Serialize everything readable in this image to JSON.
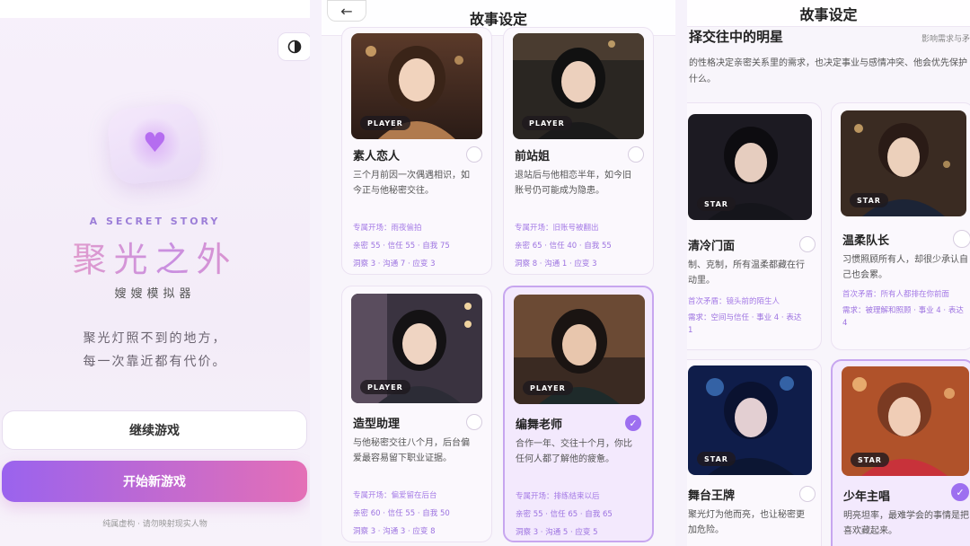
{
  "title_screen": {
    "eyebrow": "A SECRET STORY",
    "title": "聚光之外",
    "subtitle": "嫂嫂模拟器",
    "tagline_1": "聚光灯照不到的地方，",
    "tagline_2": "每一次靠近都有代价。",
    "continue_label": "继续游戏",
    "new_game_label": "开始新游戏",
    "disclaimer": "纯属虚构 · 请勿映射现实人物"
  },
  "story_setup": {
    "header_title": "故事设定",
    "back_icon": "←",
    "player_cards": [
      {
        "name": "素人恋人",
        "tag": "PLAYER",
        "selected": false,
        "desc": "三个月前因一次偶遇相识，如今正与他秘密交往。",
        "special": "专属开场：雨夜偷拍",
        "stats_1": "亲密 55 · 信任 55 · 自我 75",
        "stats_2": "洞察 3 · 沟通 7 · 应变 3"
      },
      {
        "name": "前站姐",
        "tag": "PLAYER",
        "selected": false,
        "desc": "退站后与他相恋半年，如今旧账号仍可能成为隐患。",
        "special": "专属开场：旧账号被翻出",
        "stats_1": "亲密 65 · 信任 40 · 自我 55",
        "stats_2": "洞察 8 · 沟通 1 · 应变 3"
      },
      {
        "name": "造型助理",
        "tag": "PLAYER",
        "selected": false,
        "desc": "与他秘密交往八个月，后台偏爱最容易留下职业证据。",
        "special": "专属开场：偏爱留在后台",
        "stats_1": "亲密 60 · 信任 55 · 自我 50",
        "stats_2": "洞察 3 · 沟通 3 · 应变 8"
      },
      {
        "name": "编舞老师",
        "tag": "PLAYER",
        "selected": true,
        "desc": "合作一年、交往十个月，你比任何人都了解他的疲惫。",
        "special": "专属开场：排练结束以后",
        "stats_1": "亲密 55 · 信任 65 · 自我 65",
        "stats_2": "洞察 3 · 沟通 5 · 应变 5"
      }
    ]
  },
  "star_select": {
    "header_title": "故事设定",
    "section_title": "择交往中的明星",
    "section_right": "影响需求与矛",
    "section_desc": "的性格决定亲密关系里的需求，也决定事业与感情冲突、他会优先保护什么。",
    "star_cards": [
      {
        "name": "清冷门面",
        "tag": "STAR",
        "selected": false,
        "desc": "制、克制，所有温柔都藏在行动里。",
        "conflict": "首次矛盾：镜头前的陌生人",
        "need": "需求：空间与信任 · 事业 4 · 表达 1"
      },
      {
        "name": "温柔队长",
        "tag": "STAR",
        "selected": false,
        "desc": "习惯照顾所有人，却很少承认自己也会累。",
        "conflict": "首次矛盾：所有人都排在你前面",
        "need": "需求：被理解和照顾 · 事业 4 · 表达 4"
      },
      {
        "name": "舞台王牌",
        "tag": "STAR",
        "selected": false,
        "desc": "聚光灯为他而亮，也让秘密更加危险。"
      },
      {
        "name": "少年主唱",
        "tag": "STAR",
        "selected": true,
        "desc": "明亮坦率，最难学会的事情是把喜欢藏起来。"
      }
    ]
  }
}
